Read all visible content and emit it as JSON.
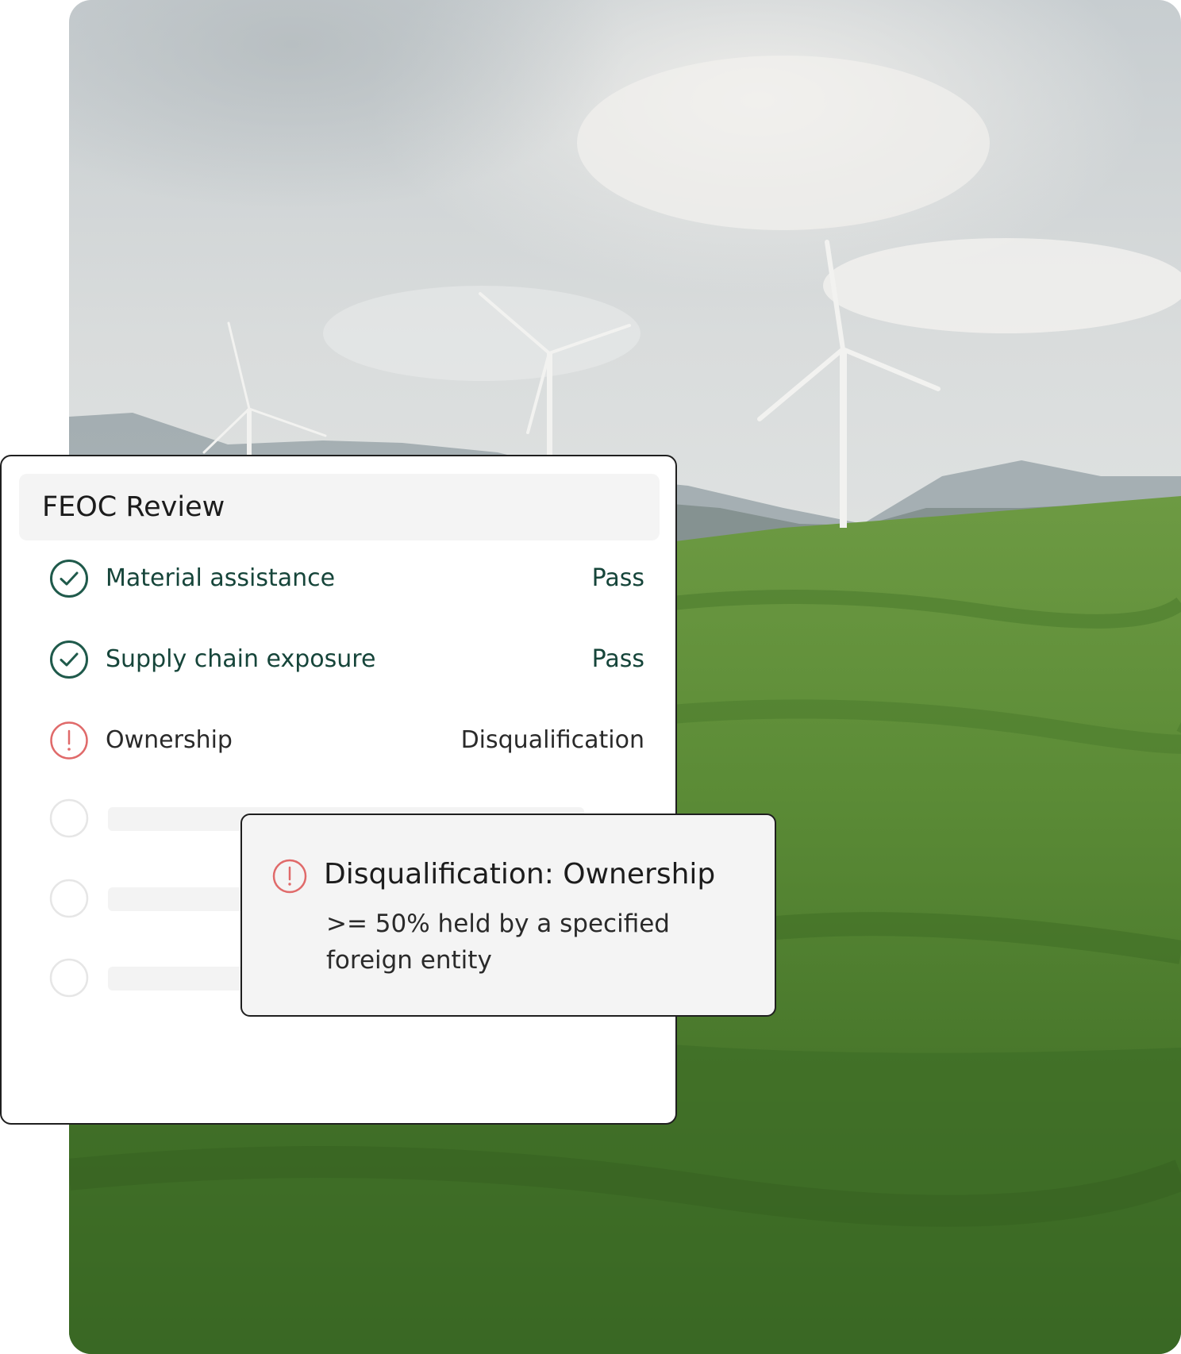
{
  "review": {
    "title": "FEOC Review",
    "items": [
      {
        "label": "Material assistance",
        "status": "Pass",
        "state": "pass"
      },
      {
        "label": "Supply chain exposure",
        "status": "Pass",
        "state": "pass"
      },
      {
        "label": "Ownership",
        "status": "Disqualification",
        "state": "fail"
      }
    ],
    "placeholder_count": 3
  },
  "detail": {
    "title": "Disqualification: Ownership",
    "body": ">= 50% held by a specified foreign entity"
  },
  "colors": {
    "pass": "#1f5a4b",
    "fail": "#e06a6a",
    "placeholder_ring": "#e6e6e6"
  },
  "icons": {
    "pass": "check-circle-icon",
    "fail": "alert-circle-icon",
    "placeholder": "empty-circle-icon"
  },
  "background": {
    "image": "wind-turbines-hills-photo"
  }
}
